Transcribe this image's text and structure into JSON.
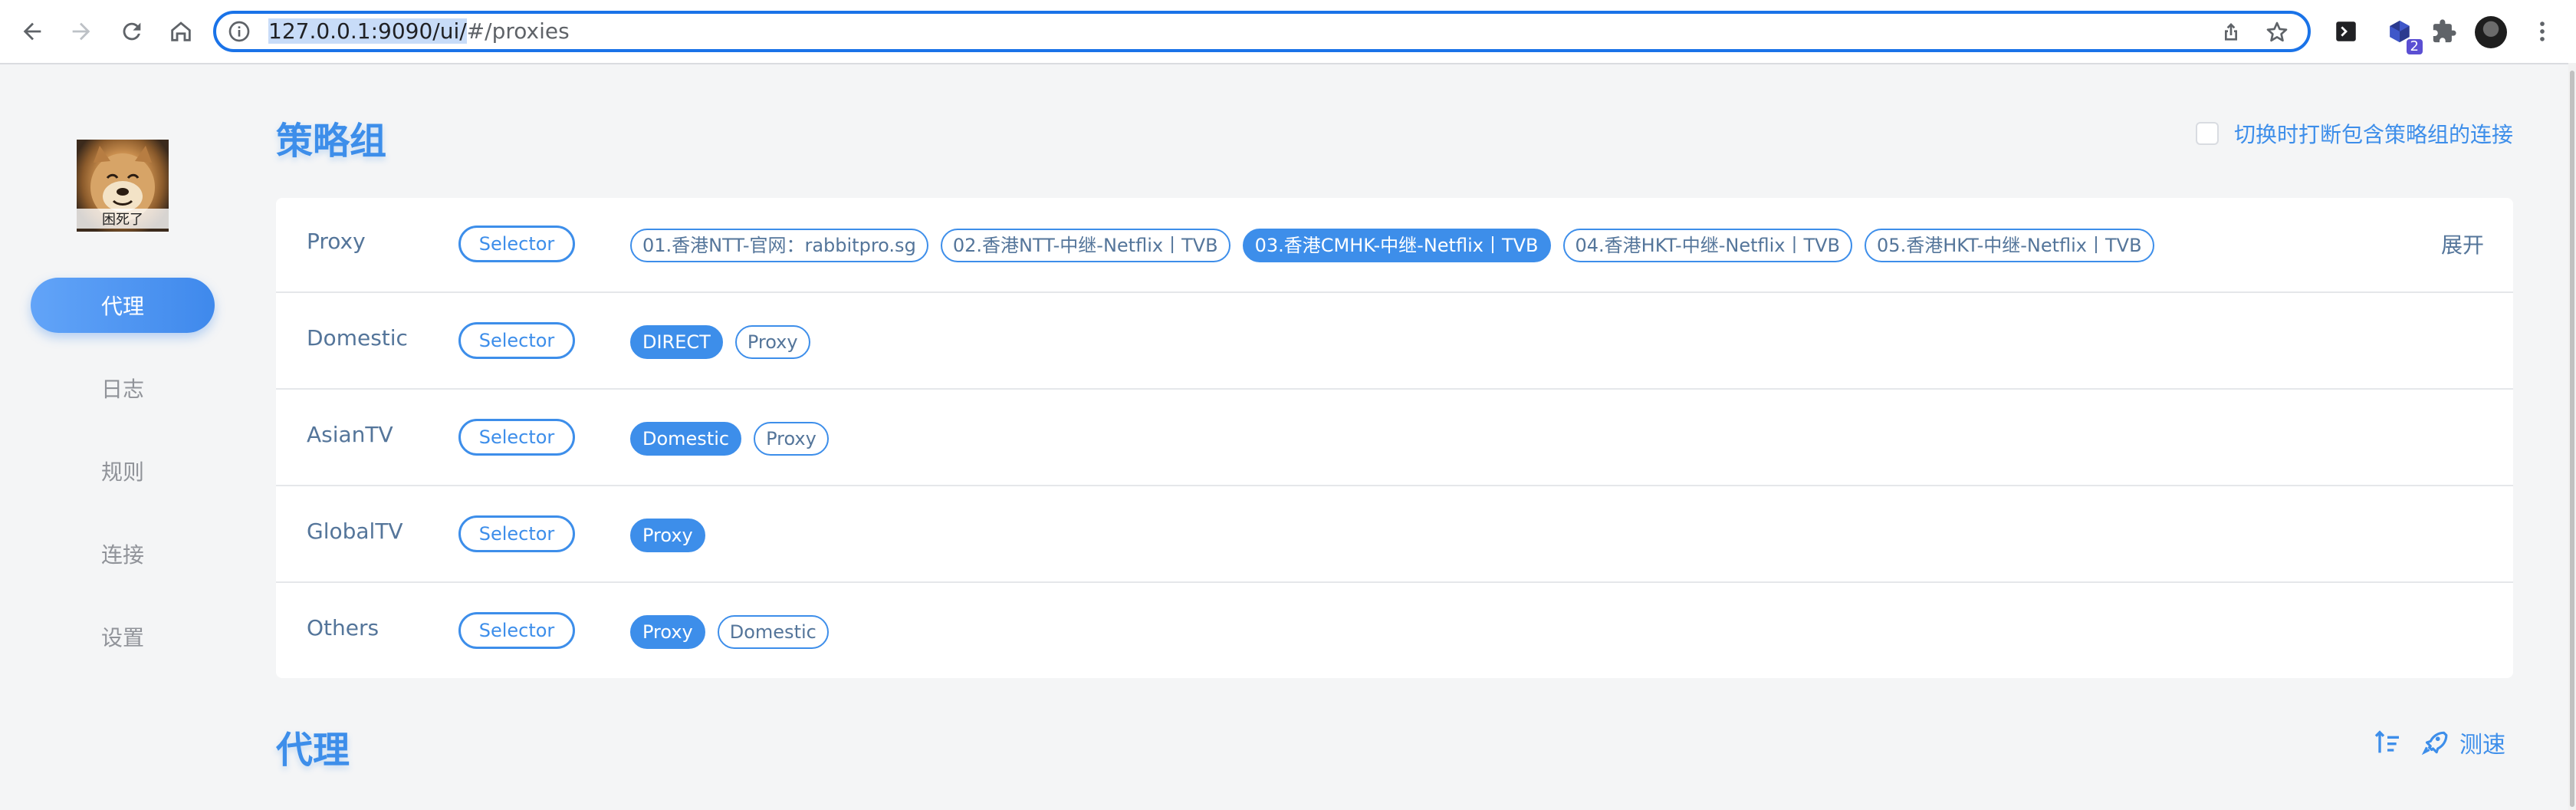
{
  "browser": {
    "url_host": "127.0.0.1:9090/ui/",
    "url_rest": "#/proxies",
    "extension_badge": "2"
  },
  "sidebar": {
    "avatar_caption": "困死了",
    "items": [
      {
        "label": "代理",
        "active": true
      },
      {
        "label": "日志"
      },
      {
        "label": "规则"
      },
      {
        "label": "连接"
      },
      {
        "label": "设置"
      }
    ]
  },
  "groups_section": {
    "title": "策略组",
    "disconnect_label": "切换时打断包含策略组的连接",
    "expand_label": "展开",
    "groups": [
      {
        "name": "Proxy",
        "type": "Selector",
        "proxies": [
          "01.香港NTT-官网：rabbitpro.sg",
          "02.香港NTT-中继-Netflix丨TVB",
          "03.香港CMHK-中继-Netflix丨TVB",
          "04.香港HKT-中继-Netflix丨TVB",
          "05.香港HKT-中继-Netflix丨TVB"
        ],
        "selected": "03.香港CMHK-中继-Netflix丨TVB"
      },
      {
        "name": "Domestic",
        "type": "Selector",
        "proxies": [
          "DIRECT",
          "Proxy"
        ],
        "selected": "DIRECT"
      },
      {
        "name": "AsianTV",
        "type": "Selector",
        "proxies": [
          "Domestic",
          "Proxy"
        ],
        "selected": "Domestic"
      },
      {
        "name": "GlobalTV",
        "type": "Selector",
        "proxies": [
          "Proxy"
        ],
        "selected": "Proxy"
      },
      {
        "name": "Others",
        "type": "Selector",
        "proxies": [
          "Proxy",
          "Domestic"
        ],
        "selected": "Proxy"
      }
    ]
  },
  "proxies_section": {
    "title": "代理",
    "speed_test_label": "测速"
  },
  "colors": {
    "accent": "#3d8eea",
    "text": "#54759a",
    "background": "#f4f5f6"
  }
}
